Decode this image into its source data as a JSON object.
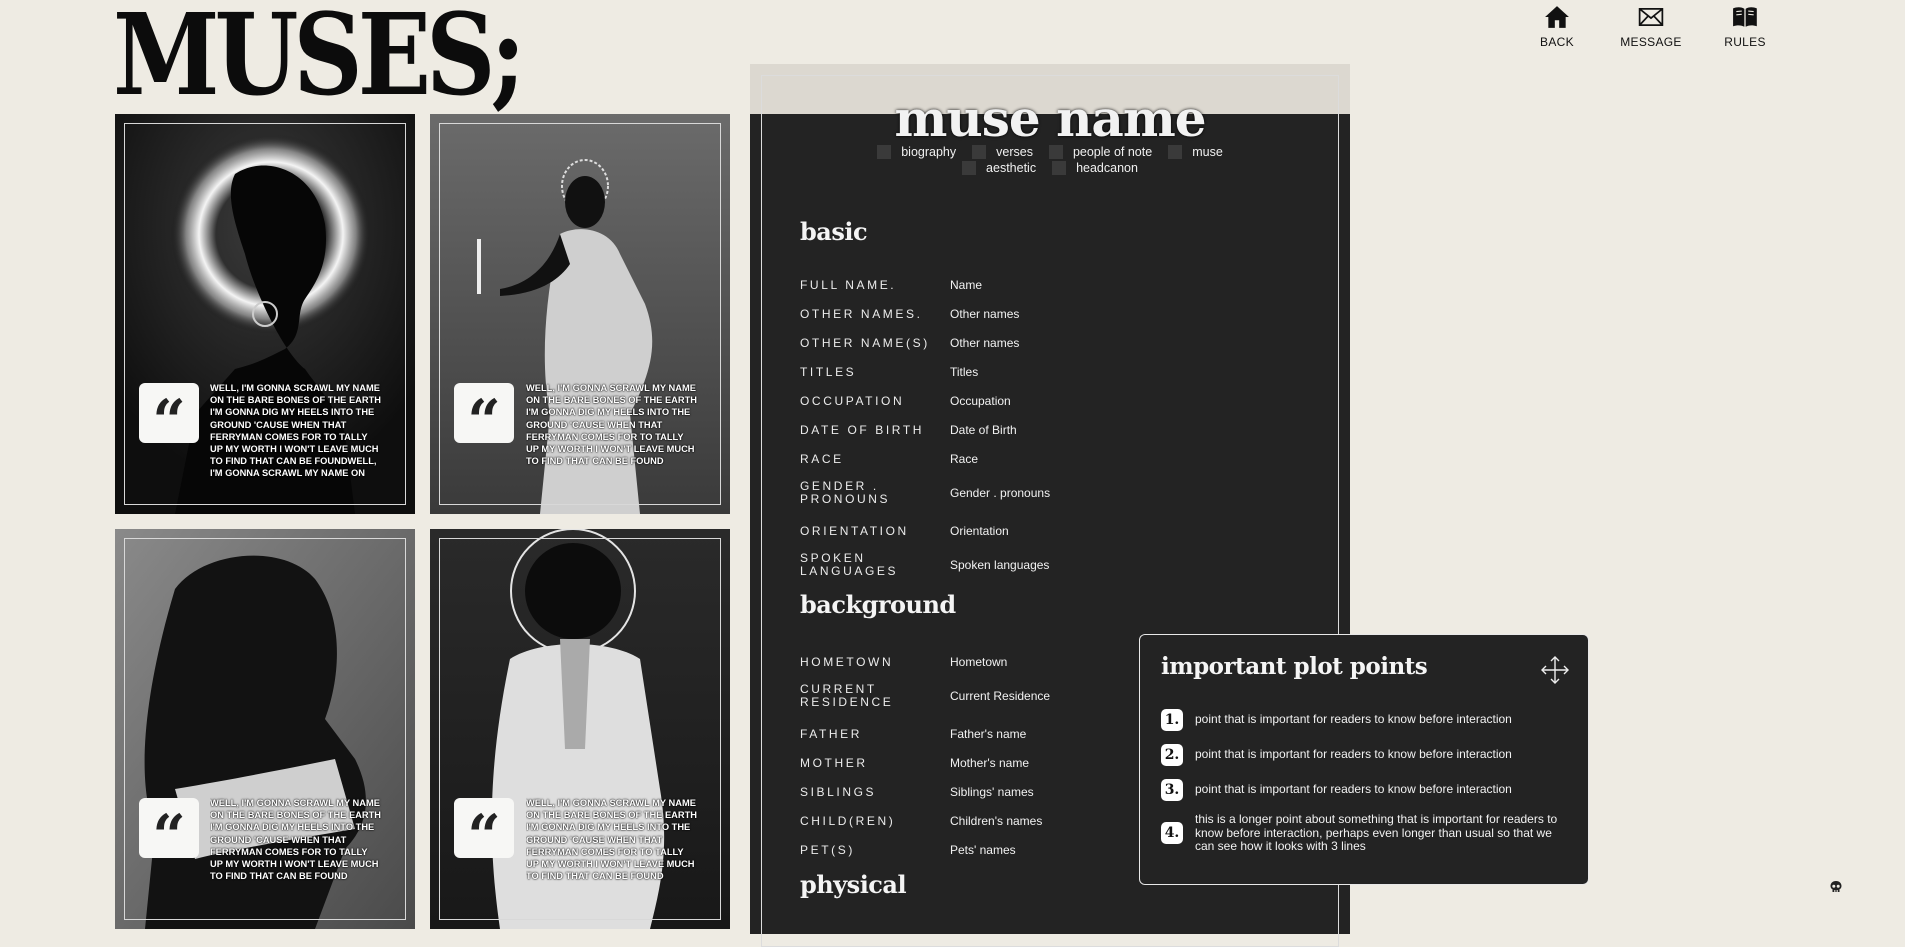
{
  "site": {
    "title": "MUSES;"
  },
  "nav": [
    {
      "label": "BACK",
      "icon": "home-icon"
    },
    {
      "label": "MESSAGE",
      "icon": "envelope-icon"
    },
    {
      "label": "RULES",
      "icon": "book-icon"
    }
  ],
  "gallery": {
    "quote_icon": "“",
    "cards": [
      {
        "quote": "WELL, I'M GONNA SCRAWL MY NAME ON THE BARE BONES OF THE EARTH I'M GONNA DIG MY HEELS INTO THE GROUND 'CAUSE WHEN THAT FERRYMAN COMES FOR TO TALLY UP MY WORTH I WON'T LEAVE MUCH TO FIND THAT CAN BE FOUNDWELL, I'M GONNA SCRAWL MY NAME ON THE BARE BONES OF THE EARTH"
      },
      {
        "quote": "WELL, I'M GONNA SCRAWL MY NAME ON THE BARE BONES OF THE EARTH I'M GONNA DIG MY HEELS INTO THE GROUND 'CAUSE WHEN THAT FERRYMAN COMES FOR TO TALLY UP MY WORTH I WON'T LEAVE MUCH TO FIND THAT CAN BE FOUND"
      },
      {
        "quote": "WELL, I'M GONNA SCRAWL MY NAME ON THE BARE BONES OF THE EARTH I'M GONNA DIG MY HEELS INTO THE GROUND 'CAUSE WHEN THAT FERRYMAN COMES FOR TO TALLY UP MY WORTH I WON'T LEAVE MUCH TO FIND THAT CAN BE FOUND"
      },
      {
        "quote": "WELL, I'M GONNA SCRAWL MY NAME ON THE BARE BONES OF THE EARTH I'M GONNA DIG MY HEELS INTO THE GROUND 'CAUSE WHEN THAT FERRYMAN COMES FOR TO TALLY UP MY WORTH I WON'T LEAVE MUCH TO FIND THAT CAN BE FOUND"
      }
    ]
  },
  "profile": {
    "name": "muse name",
    "tabs": [
      "biography",
      "verses",
      "people of note",
      "muse",
      "aesthetic",
      "headcanon"
    ],
    "basic": {
      "heading": "basic",
      "fields": [
        {
          "label": "FULL NAME.",
          "value": "Name"
        },
        {
          "label": "OTHER NAMES.",
          "value": "Other names"
        },
        {
          "label": "OTHER NAME(S)",
          "value": "Other names"
        },
        {
          "label": "TITLES",
          "value": "Titles"
        },
        {
          "label": "OCCUPATION",
          "value": "Occupation"
        },
        {
          "label": "DATE OF BIRTH",
          "value": "Date of Birth"
        },
        {
          "label": "RACE",
          "value": "Race"
        },
        {
          "label": "GENDER . PRONOUNS",
          "value": "Gender . pronouns"
        },
        {
          "label": "ORIENTATION",
          "value": "Orientation"
        },
        {
          "label": "SPOKEN LANGUAGES",
          "value": "Spoken languages"
        }
      ]
    },
    "background": {
      "heading": "background",
      "fields": [
        {
          "label": "HOMETOWN",
          "value": "Hometown"
        },
        {
          "label": "CURRENT RESIDENCE",
          "value": "Current Residence"
        },
        {
          "label": "FATHER",
          "value": "Father's name"
        },
        {
          "label": "MOTHER",
          "value": "Mother's name"
        },
        {
          "label": "SIBLINGS",
          "value": "Siblings' names"
        },
        {
          "label": "CHILD(REN)",
          "value": "Children's names"
        },
        {
          "label": "PET(S)",
          "value": "Pets' names"
        }
      ]
    },
    "physical": {
      "heading": "physical"
    }
  },
  "plot_points": {
    "title": "important plot points",
    "move_icon": "move-arrows-icon",
    "items": [
      {
        "num": "1.",
        "text": "point that is important for readers to know before interaction"
      },
      {
        "num": "2.",
        "text": "point that is important for readers to know before interaction"
      },
      {
        "num": "3.",
        "text": "point that is important for readers to know before interaction"
      },
      {
        "num": "4.",
        "text": "this is a longer point about something that is important for readers to know before interaction, perhaps even longer than usual so that we can see how it looks with 3 lines"
      }
    ]
  },
  "footer": {
    "icon": "skull-icon"
  }
}
